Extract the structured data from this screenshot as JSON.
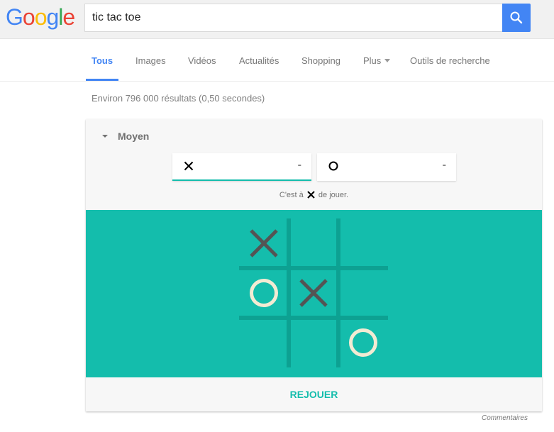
{
  "header": {
    "logo_letters": [
      {
        "ch": "G",
        "color": "#4285f4"
      },
      {
        "ch": "o",
        "color": "#ea4335"
      },
      {
        "ch": "o",
        "color": "#fbbc05"
      },
      {
        "ch": "g",
        "color": "#4285f4"
      },
      {
        "ch": "l",
        "color": "#34a853"
      },
      {
        "ch": "e",
        "color": "#ea4335"
      }
    ],
    "search_value": "tic tac toe",
    "search_icon": "search-icon"
  },
  "nav": {
    "tabs": [
      {
        "label": "Tous",
        "active": true
      },
      {
        "label": "Images"
      },
      {
        "label": "Vidéos"
      },
      {
        "label": "Actualités"
      },
      {
        "label": "Shopping"
      },
      {
        "label": "Plus"
      },
      {
        "label": "Outils de recherche"
      }
    ]
  },
  "results": {
    "stats": "Environ 796 000 résultats (0,50 secondes)"
  },
  "game": {
    "difficulty": "Moyen",
    "players": [
      {
        "symbol": "X",
        "score": "-",
        "active": true
      },
      {
        "symbol": "O",
        "score": "-",
        "active": false
      }
    ],
    "turn_prefix": "C'est à",
    "turn_symbol": "X",
    "turn_suffix": "de jouer.",
    "board": [
      [
        "X",
        "",
        ""
      ],
      [
        "O",
        "X",
        ""
      ],
      [
        "",
        "",
        "O"
      ]
    ],
    "colors": {
      "board_bg": "#14bdac",
      "grid_line": "#0da192",
      "x_mark": "#545454",
      "o_mark": "#f2ebd3",
      "accent": "#14bdac"
    },
    "replay_label": "REJOUER"
  },
  "footer": {
    "feedback_label": "Commentaires"
  }
}
